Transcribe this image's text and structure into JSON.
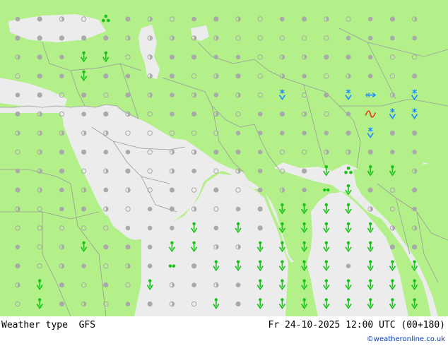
{
  "footer": {
    "title": "Weather type  GFS",
    "valid_time": "Fr 24-10-2025 12:00 UTC (00+180)",
    "credit": "©weatheronline.co.uk"
  },
  "colors": {
    "land": "#b3f08a",
    "sea": "#ececec",
    "border": "#9a9a9a",
    "cloud": "#a9a9a9",
    "rain": "#16c316",
    "snow": "#1b8bff",
    "fog": "#e33c12"
  },
  "legend_note": "",
  "symbols": [
    {
      "col": 4,
      "row": 0,
      "type": "rain-cluster"
    },
    {
      "col": 3,
      "row": 2,
      "type": "rain-arrow"
    },
    {
      "col": 4,
      "row": 2,
      "type": "rain-arrow"
    },
    {
      "col": 3,
      "row": 3,
      "type": "rain-arrow"
    },
    {
      "col": 12,
      "row": 4,
      "type": "snow-arrow"
    },
    {
      "col": 15,
      "row": 4,
      "type": "snow-arrow"
    },
    {
      "col": 16,
      "row": 4,
      "type": "snow-drift"
    },
    {
      "col": 18,
      "row": 4,
      "type": "snow-arrow"
    },
    {
      "col": 16,
      "row": 5,
      "type": "fog"
    },
    {
      "col": 17,
      "row": 5,
      "type": "snow-arrow"
    },
    {
      "col": 18,
      "row": 5,
      "type": "snow-arrow"
    },
    {
      "col": 16,
      "row": 6,
      "type": "snow-arrow"
    },
    {
      "col": 14,
      "row": 8,
      "type": "rain-arrow"
    },
    {
      "col": 15,
      "row": 8,
      "type": "rain-cluster"
    },
    {
      "col": 16,
      "row": 8,
      "type": "rain-arrow"
    },
    {
      "col": 17,
      "row": 8,
      "type": "rain-arrow"
    },
    {
      "col": 14,
      "row": 9,
      "type": "rain-dots"
    },
    {
      "col": 15,
      "row": 9,
      "type": "rain-arrow"
    },
    {
      "col": 12,
      "row": 10,
      "type": "rain-arrow"
    },
    {
      "col": 13,
      "row": 10,
      "type": "rain-arrow"
    },
    {
      "col": 14,
      "row": 10,
      "type": "rain-arrow"
    },
    {
      "col": 15,
      "row": 10,
      "type": "rain-arrow"
    },
    {
      "col": 8,
      "row": 11,
      "type": "rain-arrow"
    },
    {
      "col": 10,
      "row": 11,
      "type": "rain-arrow"
    },
    {
      "col": 12,
      "row": 11,
      "type": "rain-arrow"
    },
    {
      "col": 13,
      "row": 11,
      "type": "rain-arrow"
    },
    {
      "col": 14,
      "row": 11,
      "type": "rain-arrow"
    },
    {
      "col": 15,
      "row": 11,
      "type": "rain-arrow"
    },
    {
      "col": 16,
      "row": 11,
      "type": "rain-arrow"
    },
    {
      "col": 3,
      "row": 12,
      "type": "rain-arrow"
    },
    {
      "col": 7,
      "row": 12,
      "type": "rain-arrow"
    },
    {
      "col": 8,
      "row": 12,
      "type": "rain-arrow"
    },
    {
      "col": 11,
      "row": 12,
      "type": "rain-arrow"
    },
    {
      "col": 12,
      "row": 12,
      "type": "rain-arrow"
    },
    {
      "col": 13,
      "row": 12,
      "type": "rain-arrow"
    },
    {
      "col": 14,
      "row": 12,
      "type": "rain-arrow"
    },
    {
      "col": 15,
      "row": 12,
      "type": "rain-arrow"
    },
    {
      "col": 16,
      "row": 12,
      "type": "rain-arrow"
    },
    {
      "col": 7,
      "row": 13,
      "type": "rain-dots"
    },
    {
      "col": 9,
      "row": 13,
      "type": "rain-arrow"
    },
    {
      "col": 10,
      "row": 13,
      "type": "rain-arrow"
    },
    {
      "col": 11,
      "row": 13,
      "type": "rain-arrow"
    },
    {
      "col": 12,
      "row": 13,
      "type": "rain-arrow"
    },
    {
      "col": 13,
      "row": 13,
      "type": "rain-arrow"
    },
    {
      "col": 14,
      "row": 13,
      "type": "rain-arrow"
    },
    {
      "col": 16,
      "row": 13,
      "type": "rain-arrow"
    },
    {
      "col": 17,
      "row": 13,
      "type": "rain-arrow"
    },
    {
      "col": 18,
      "row": 13,
      "type": "rain-arrow"
    },
    {
      "col": 1,
      "row": 14,
      "type": "rain-arrow"
    },
    {
      "col": 6,
      "row": 14,
      "type": "rain-arrow"
    },
    {
      "col": 11,
      "row": 14,
      "type": "rain-arrow"
    },
    {
      "col": 12,
      "row": 14,
      "type": "rain-arrow"
    },
    {
      "col": 13,
      "row": 14,
      "type": "rain-arrow"
    },
    {
      "col": 14,
      "row": 14,
      "type": "rain-arrow"
    },
    {
      "col": 15,
      "row": 14,
      "type": "rain-arrow"
    },
    {
      "col": 16,
      "row": 14,
      "type": "rain-arrow"
    },
    {
      "col": 17,
      "row": 14,
      "type": "rain-arrow"
    },
    {
      "col": 18,
      "row": 14,
      "type": "rain-arrow"
    },
    {
      "col": 1,
      "row": 15,
      "type": "rain-arrow"
    },
    {
      "col": 9,
      "row": 15,
      "type": "rain-arrow"
    },
    {
      "col": 11,
      "row": 15,
      "type": "rain-arrow"
    },
    {
      "col": 12,
      "row": 15,
      "type": "rain-arrow"
    },
    {
      "col": 13,
      "row": 15,
      "type": "rain-arrow"
    },
    {
      "col": 14,
      "row": 15,
      "type": "rain-arrow"
    },
    {
      "col": 15,
      "row": 15,
      "type": "rain-arrow"
    },
    {
      "col": 16,
      "row": 15,
      "type": "rain-arrow"
    },
    {
      "col": 17,
      "row": 15,
      "type": "rain-arrow"
    },
    {
      "col": 18,
      "row": 15,
      "type": "rain-arrow"
    }
  ]
}
